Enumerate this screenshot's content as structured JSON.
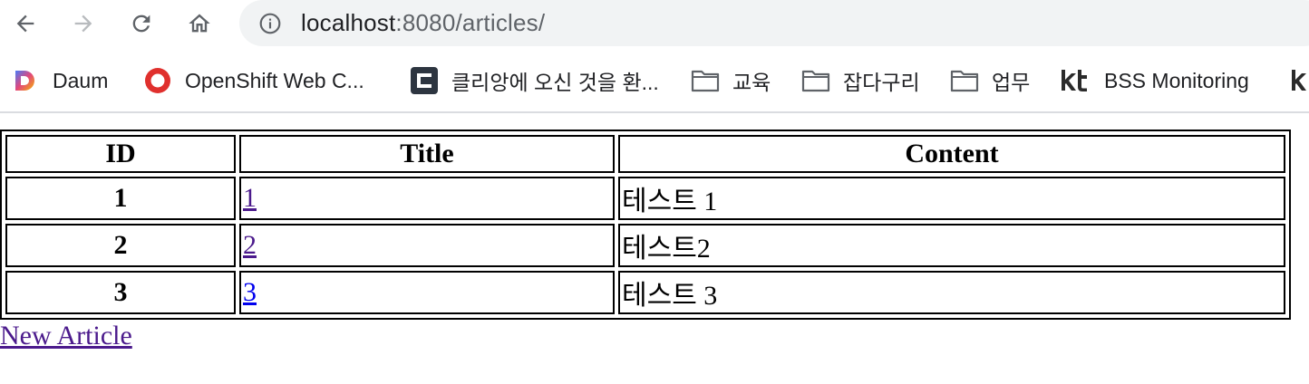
{
  "browser": {
    "url_host": "localhost",
    "url_rest": ":8080/articles/",
    "bookmarks": [
      {
        "label": "Daum",
        "icon": "daum-icon"
      },
      {
        "label": "OpenShift Web C...",
        "icon": "openshift-icon"
      },
      {
        "label": "클리앙에 오신 것을 환...",
        "icon": "clien-icon"
      },
      {
        "label": "교육",
        "icon": "folder-icon"
      },
      {
        "label": "잡다구리",
        "icon": "folder-icon"
      },
      {
        "label": "업무",
        "icon": "folder-icon"
      },
      {
        "label": "BSS Monitoring",
        "icon": "kt-icon"
      }
    ]
  },
  "table": {
    "headers": {
      "id": "ID",
      "title": "Title",
      "content": "Content"
    },
    "rows": [
      {
        "id": "1",
        "title": "1",
        "content": "테스트 1"
      },
      {
        "id": "2",
        "title": "2",
        "content": "테스트2"
      },
      {
        "id": "3",
        "title": "3",
        "content": "테스트 3"
      }
    ]
  },
  "new_article_link": "New Article",
  "colors": {
    "visited_link": "#4b1a8c",
    "unvisited_link": "#0000ee",
    "omnibox_bg": "#f1f3f4"
  }
}
